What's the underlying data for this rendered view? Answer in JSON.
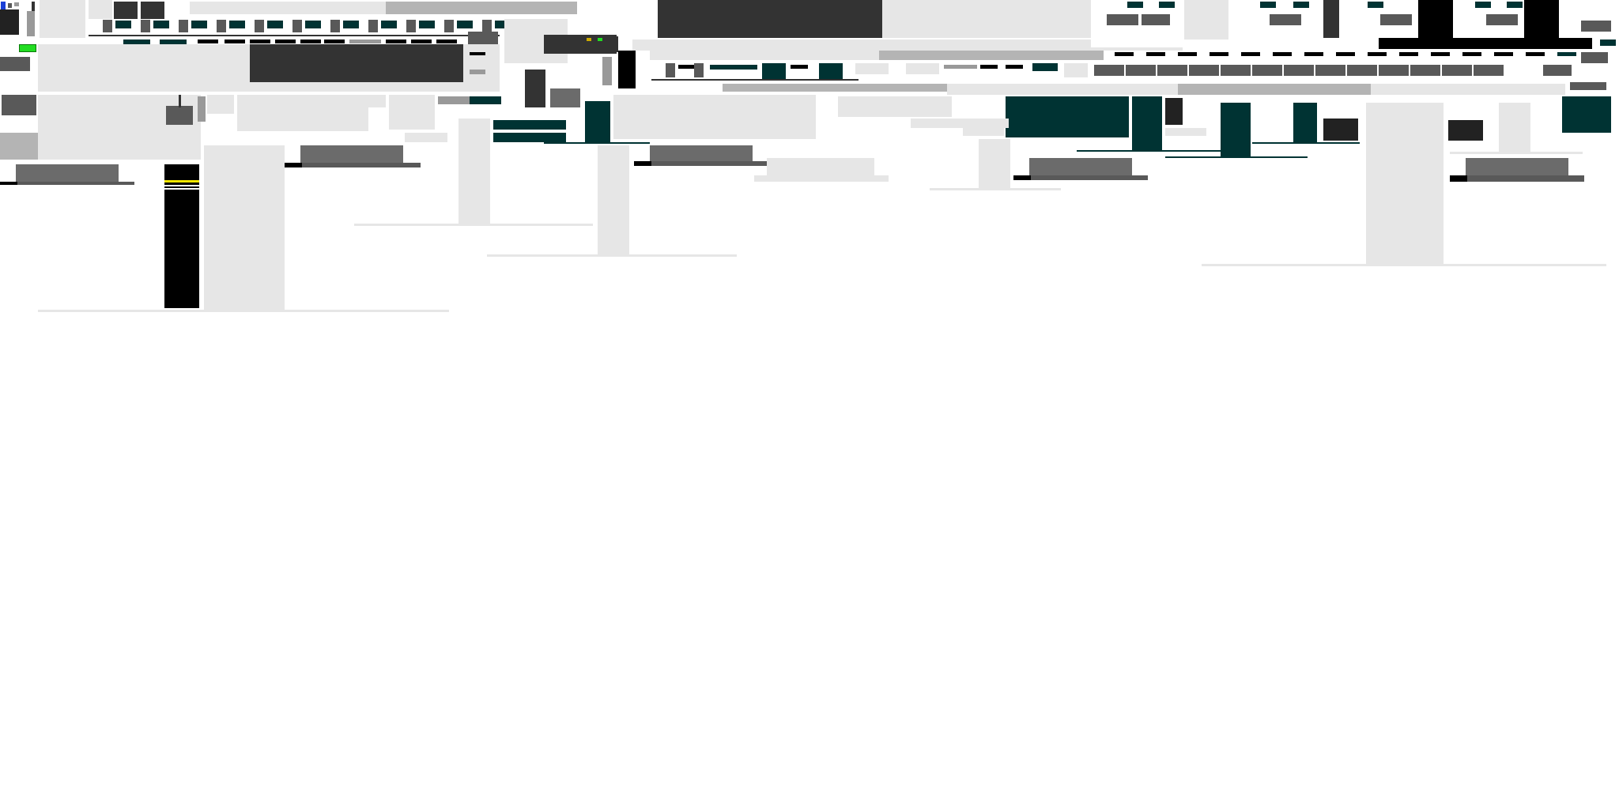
{
  "colors": {
    "panel": "#e6e6e6",
    "panel_mid": "#b4b4b4",
    "widget": "#595959",
    "widget_dark": "#333333",
    "teal": "#003333",
    "black": "#000000",
    "yellow_stripe": "#f2e600",
    "green_indicator": "#22dd22",
    "blue_indicator": "#1a3fd6"
  }
}
